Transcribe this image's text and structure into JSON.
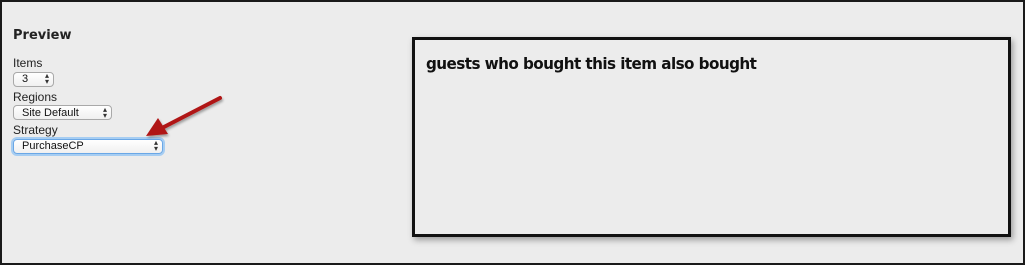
{
  "preview": {
    "heading": "Preview",
    "items": {
      "label": "Items",
      "value": "3"
    },
    "regions": {
      "label": "Regions",
      "value": "Site Default"
    },
    "strategy": {
      "label": "Strategy",
      "value": "PurchaseCP"
    }
  },
  "widget": {
    "title": "guests who bought this item also bought"
  },
  "colors": {
    "annotation_arrow": "#b01515",
    "focus_ring": "#6aa7e6"
  }
}
